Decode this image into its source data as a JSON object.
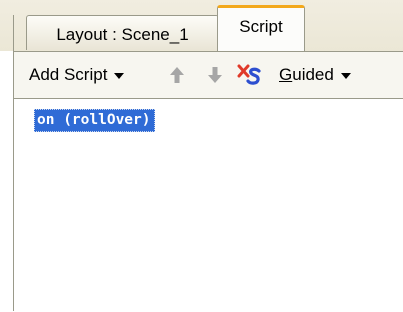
{
  "tabs": [
    {
      "label": "Layout : Scene_1",
      "active": false
    },
    {
      "label": "Script",
      "active": true
    }
  ],
  "toolbar": {
    "add_script_label": "Add Script",
    "move_up_icon": "arrow-up-icon",
    "move_down_icon": "arrow-down-icon",
    "delete_icon": "delete-script-icon",
    "guided_label_first": "G",
    "guided_label_rest": "uided"
  },
  "editor": {
    "lines": [
      "on (rollOver)"
    ]
  },
  "colors": {
    "active_tab_accent": "#f3a81a",
    "selection": "#2f6bd6",
    "disabled_arrow": "#a6a6a6",
    "delete_red": "#e03a2a",
    "delete_blue": "#2d4fd0"
  }
}
